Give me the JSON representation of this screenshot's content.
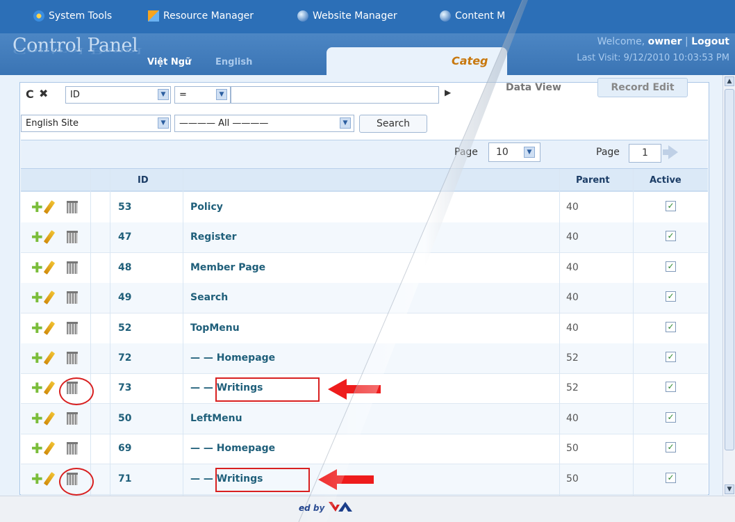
{
  "topmenu": {
    "items": [
      {
        "label": "System Tools",
        "icon": "tools-icon"
      },
      {
        "label": "Resource Manager",
        "icon": "resource-icon"
      },
      {
        "label": "Website Manager",
        "icon": "globe-icon"
      },
      {
        "label": "Content M",
        "icon": "globe-icon"
      }
    ]
  },
  "header": {
    "logo": "Control Panel",
    "lang_vn": "Việt Ngữ",
    "lang_en": "English",
    "active_tab": "Categ",
    "welcome_prefix": "Welcome,",
    "user": "owner",
    "separator": "|",
    "logout": "Logout",
    "last_visit": "Last Visit: 9/12/2010 10:03:53 PM"
  },
  "toolbar": {
    "field_select": "ID",
    "operator_select": "=",
    "site_select": "English Site",
    "filter_select": "———— All ————",
    "search_label": "Search",
    "data_view_label": "Data View",
    "record_edit_label": "Record Edit"
  },
  "pager": {
    "page_size_label": "Page",
    "page_size": "10",
    "page_label": "Page",
    "page": "1"
  },
  "grid": {
    "headers": {
      "id": "ID",
      "parent": "Parent",
      "active": "Active"
    },
    "rows": [
      {
        "id": "53",
        "name": "Policy",
        "parent": "40",
        "active": true
      },
      {
        "id": "47",
        "name": "Register",
        "parent": "40",
        "active": true
      },
      {
        "id": "48",
        "name": "Member Page",
        "parent": "40",
        "active": true
      },
      {
        "id": "49",
        "name": "Search",
        "parent": "40",
        "active": true
      },
      {
        "id": "52",
        "name": "TopMenu",
        "parent": "40",
        "active": true
      },
      {
        "id": "72",
        "name": "— — Homepage",
        "parent": "52",
        "active": true
      },
      {
        "id": "73",
        "name": "— — Writings",
        "parent": "52",
        "active": true
      },
      {
        "id": "50",
        "name": "LeftMenu",
        "parent": "40",
        "active": true
      },
      {
        "id": "69",
        "name": "— — Homepage",
        "parent": "50",
        "active": true
      },
      {
        "id": "71",
        "name": "— — Writings",
        "parent": "50",
        "active": true
      }
    ]
  },
  "footer": {
    "powered_by": "ed by"
  },
  "colors": {
    "topbar": "#2c6fb7",
    "accent_red": "#d82020",
    "link_text": "#1f5f7a"
  }
}
